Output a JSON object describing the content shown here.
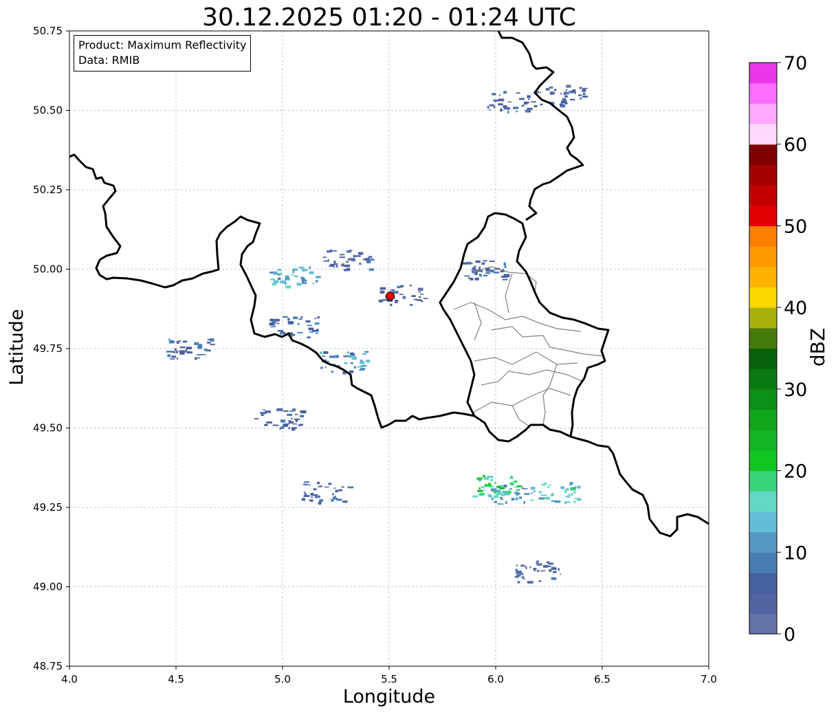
{
  "title": "30.12.2025 01:20 - 01:24 UTC",
  "info_box": {
    "product": "Product: Maximum Reflectivity",
    "data": "Data: RMIB"
  },
  "axes": {
    "xlabel": "Longitude",
    "ylabel": "Latitude",
    "xlim": [
      4.0,
      7.0
    ],
    "ylim": [
      48.75,
      50.75
    ],
    "xticks": [
      "4.0",
      "4.5",
      "5.0",
      "5.5",
      "6.0",
      "6.5",
      "7.0"
    ],
    "yticks": [
      "48.75",
      "49.00",
      "49.25",
      "49.50",
      "49.75",
      "50.00",
      "50.25",
      "50.50",
      "50.75"
    ],
    "grid": true
  },
  "colorbar": {
    "label": "dBZ",
    "range": [
      0,
      70
    ],
    "ticks": [
      "0",
      "10",
      "20",
      "30",
      "40",
      "50",
      "60",
      "70"
    ],
    "colors": [
      "#6373a8",
      "#5264a2",
      "#4660a0",
      "#4a7cb4",
      "#5499c4",
      "#63bcd8",
      "#63d8c4",
      "#3ad47a",
      "#10c621",
      "#14b522",
      "#10a61a",
      "#0d9016",
      "#0a7a10",
      "#066208",
      "#457b0a",
      "#aab00e",
      "#fcd700",
      "#fbb300",
      "#fc9b00",
      "#fd7f00",
      "#e50000",
      "#c50000",
      "#a50000",
      "#7f0000",
      "#ffd8ff",
      "#ffaaff",
      "#ff6eff",
      "#ec36ec"
    ]
  },
  "radar_marker": {
    "lon": 5.505,
    "lat": 49.915,
    "color": "#e00000"
  },
  "echo_regions": [
    {
      "lon": 5.3,
      "lat": 50.03,
      "dbz": 5
    },
    {
      "lon": 5.55,
      "lat": 49.92,
      "dbz": 5
    },
    {
      "lon": 5.05,
      "lat": 49.82,
      "dbz": 8
    },
    {
      "lon": 4.55,
      "lat": 49.75,
      "dbz": 6
    },
    {
      "lon": 5.28,
      "lat": 49.71,
      "dbz": 10
    },
    {
      "lon": 4.98,
      "lat": 49.53,
      "dbz": 6
    },
    {
      "lon": 6.05,
      "lat": 49.29,
      "dbz": 12
    },
    {
      "lon": 6.0,
      "lat": 49.32,
      "dbz": 20
    },
    {
      "lon": 6.27,
      "lat": 49.3,
      "dbz": 14
    },
    {
      "lon": 6.2,
      "lat": 49.05,
      "dbz": 5
    },
    {
      "lon": 6.07,
      "lat": 50.53,
      "dbz": 5
    },
    {
      "lon": 6.3,
      "lat": 50.55,
      "dbz": 5
    },
    {
      "lon": 5.95,
      "lat": 50.0,
      "dbz": 6
    },
    {
      "lon": 5.2,
      "lat": 49.3,
      "dbz": 5
    },
    {
      "lon": 5.05,
      "lat": 49.98,
      "dbz": 12
    }
  ]
}
